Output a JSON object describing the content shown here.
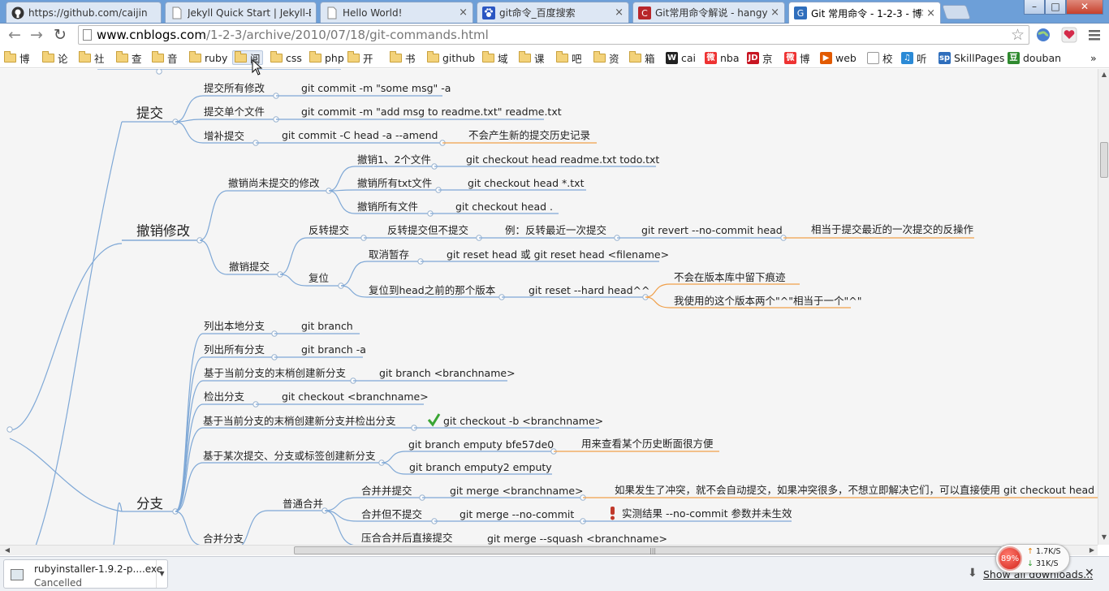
{
  "tabs": [
    {
      "label": "https://github.com/caijin",
      "icon": "github-icon",
      "active": false
    },
    {
      "label": "Jekyll Quick Start | Jekyll-B",
      "icon": "page-icon",
      "active": false
    },
    {
      "label": "Hello World!",
      "icon": "page-icon",
      "active": false
    },
    {
      "label": "git命令_百度搜索",
      "icon": "baidu-paw-icon",
      "active": false
    },
    {
      "label": "Git常用命令解说 - hangyu",
      "icon": "cnblogs-c-icon",
      "active": false
    },
    {
      "label": "Git 常用命令 - 1-2-3 - 博客",
      "icon": "cnblogs-g-icon",
      "active": true
    }
  ],
  "tab_close": "×",
  "window_controls": {
    "minimize": "–",
    "maximize": "□",
    "close": "✕"
  },
  "address": {
    "host": "www.cnblogs.com",
    "path": "/1-2-3/archive/2010/07/18/git-commands.html"
  },
  "bookmarks": [
    {
      "label": "博",
      "type": "folder"
    },
    {
      "label": "论",
      "type": "folder"
    },
    {
      "label": "社",
      "type": "folder"
    },
    {
      "label": "查",
      "type": "folder"
    },
    {
      "label": "音",
      "type": "folder"
    },
    {
      "label": "ruby",
      "type": "folder"
    },
    {
      "label": "阅",
      "type": "folder"
    },
    {
      "label": "css",
      "type": "folder"
    },
    {
      "label": "php",
      "type": "folder"
    },
    {
      "label": "开",
      "type": "folder"
    },
    {
      "label": "书",
      "type": "folder"
    },
    {
      "label": "github",
      "type": "folder"
    },
    {
      "label": "域",
      "type": "folder"
    },
    {
      "label": "课",
      "type": "folder"
    },
    {
      "label": "吧",
      "type": "folder"
    },
    {
      "label": "资",
      "type": "folder"
    },
    {
      "label": "箱",
      "type": "folder"
    },
    {
      "label": "cai",
      "type": "site",
      "badge": "W"
    },
    {
      "label": "nba",
      "type": "site",
      "badge": "微"
    },
    {
      "label": "京",
      "type": "site",
      "badge": "JD"
    },
    {
      "label": "博",
      "type": "site",
      "badge": "微"
    },
    {
      "label": "web",
      "type": "site",
      "badge": "▶"
    },
    {
      "label": "校",
      "type": "site",
      "badge": ""
    },
    {
      "label": "听",
      "type": "site",
      "badge": "♫"
    },
    {
      "label": "SkillPages",
      "type": "site",
      "badge": "sp"
    },
    {
      "label": "douban",
      "type": "site",
      "badge": "豆"
    }
  ],
  "bookmarks_overflow": "»",
  "mindmap": {
    "branches": {
      "commit": "提交",
      "undo": "撤销修改",
      "branch": "分支"
    },
    "commit": {
      "all": "提交所有修改",
      "all_cmd": "git commit -m \"some msg\" -a",
      "single": "提交单个文件",
      "single_cmd": "git commit -m \"add msg to readme.txt\" readme.txt",
      "amend": "增补提交",
      "amend_cmd": "git commit -C head -a --amend",
      "amend_note": "不会产生新的提交历史记录"
    },
    "undo": {
      "uncommitted": "撤销尚未提交的修改",
      "one_two": "撤销1、2个文件",
      "one_two_cmd": "git checkout head readme.txt todo.txt",
      "txt": "撤销所有txt文件",
      "txt_cmd": "git checkout head *.txt",
      "all": "撤销所有文件",
      "all_cmd": "git checkout head .",
      "undo_commit": "撤销提交",
      "revert": "反转提交",
      "revert_nocommit": "反转提交但不提交",
      "revert_eg": "例：反转最近一次提交",
      "revert_cmd": "git revert --no-commit head",
      "revert_note": "相当于提交最近的一次提交的反操作",
      "reset": "复位",
      "unstage": "取消暂存",
      "unstage_cmd": "git reset head 或 git reset head <filename>",
      "hard": "复位到head之前的那个版本",
      "hard_cmd": "git reset --hard head^^",
      "hard_note1": "不会在版本库中留下痕迹",
      "hard_note2": "我使用的这个版本两个\"^\"相当于一个\"^\""
    },
    "branch": {
      "list_local": "列出本地分支",
      "list_local_cmd": "git branch",
      "list_all": "列出所有分支",
      "list_all_cmd": "git branch -a",
      "create": "基于当前分支的末梢创建新分支",
      "create_cmd": "git branch <branchname>",
      "checkout": "检出分支",
      "checkout_cmd": "git checkout <branchname>",
      "create_checkout": "基于当前分支的末梢创建新分支并检出分支",
      "create_checkout_cmd": "git checkout -b <branchname>",
      "from_commit": "基于某次提交、分支或标签创建新分支",
      "from_commit_cmd1": "git branch emputy bfe57de0",
      "from_commit_note": "用来查看某个历史断面很方便",
      "from_commit_cmd2": "git branch emputy2 emputy",
      "normal_merge": "普通合并",
      "merge_commit": "合并并提交",
      "merge_cmd": "git merge <branchname>",
      "merge_note": "如果发生了冲突，就不会自动提交，如果冲突很多，不想立即解决它们，可以直接使用 git checkout head . 撤",
      "merge_nocommit": "合并但不提交",
      "merge_nocommit_cmd": "git merge --no-commit",
      "merge_nocommit_note": "实测结果 --no-commit 参数并未生效",
      "merge_label": "合并分支",
      "squash": "压合合并后直接提交",
      "squash_cmd": "git merge --squash <branchname>"
    }
  },
  "download": {
    "filename": "rubyinstaller-1.9.2-p....exe",
    "status": "Cancelled",
    "show_all": "Show all downloads...",
    "close": "✕"
  },
  "netmon": {
    "percent": "89%",
    "up": "1.7K/S",
    "down": "31K/S"
  },
  "colors": {
    "branch_line": "#7fa8d6",
    "note_line": "#f0a04b",
    "tab_strip": "#6d9fd8"
  }
}
